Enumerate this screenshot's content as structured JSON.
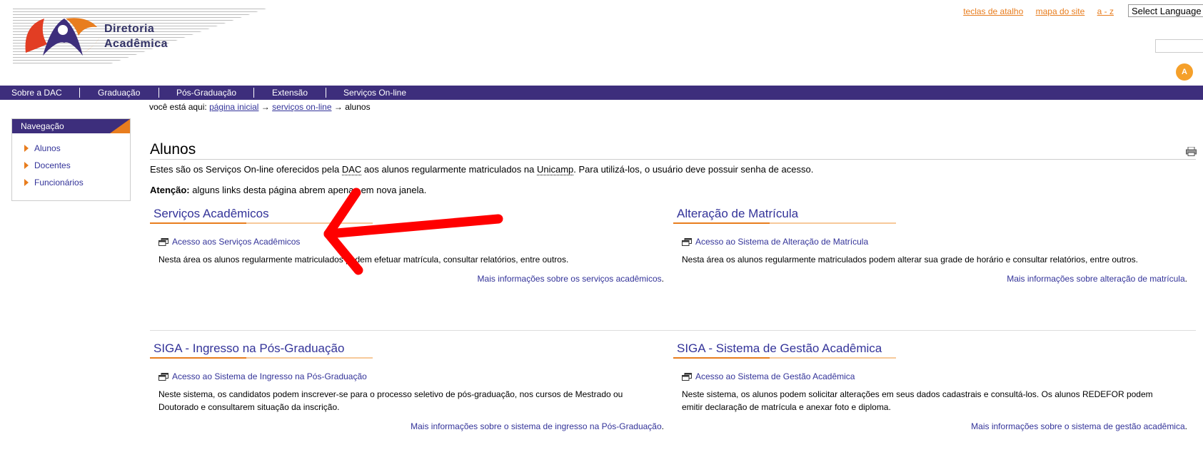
{
  "header": {
    "logo_line1": "Diretoria",
    "logo_line2": "Acadêmica",
    "top_links": [
      "teclas de atalho",
      "mapa do site",
      "a - z"
    ],
    "language_select": "Select Language",
    "accessibility_label": "A",
    "colors": {
      "nav_bg": "#3d2e7c",
      "accent": "#e87d1e",
      "link": "#333399"
    }
  },
  "nav": {
    "items": [
      "Sobre a DAC",
      "Graduação",
      "Pós-Graduação",
      "Extensão",
      "Serviços On-line"
    ]
  },
  "breadcrumb": {
    "prefix": "você está aqui:",
    "items": [
      "página inicial",
      "serviços on-line"
    ],
    "current": "alunos",
    "separator": "→"
  },
  "sidebar": {
    "title": "Navegação",
    "items": [
      "Alunos",
      "Docentes",
      "Funcionários"
    ]
  },
  "main": {
    "title": "Alunos",
    "intro_pre": "Estes são os Serviços On-line oferecidos pela",
    "intro_abbr1": "DAC",
    "intro_mid": "aos alunos regularmente matriculados na",
    "intro_abbr2": "Unicamp",
    "intro_post": ". Para utilizá-los, o usuário deve possuir senha de acesso.",
    "attention_label": "Atenção:",
    "attention_text": "alguns links desta página abrem apenas em nova janela.",
    "sections": [
      {
        "title": "Serviços Acadêmicos",
        "link": "Acesso aos Serviços Acadêmicos",
        "desc": "Nesta área os alunos regularmente matriculados podem efetuar matrícula, consultar relatórios, entre outros.",
        "more": "Mais informações sobre os serviços acadêmicos"
      },
      {
        "title": "Alteração de Matrícula",
        "link": "Acesso ao Sistema de Alteração de Matrícula",
        "desc": "Nesta área os alunos regularmente matriculados podem alterar sua grade de horário e consultar relatórios, entre outros.",
        "more": "Mais informações sobre alteração de matrícula"
      },
      {
        "title": "SIGA - Ingresso na Pós-Graduação",
        "link": "Acesso ao Sistema de Ingresso na Pós-Graduação",
        "desc": "Neste sistema, os candidatos podem inscrever-se para o processo seletivo de pós-graduação, nos cursos de Mestrado ou Doutorado e consultarem situação da inscrição.",
        "more": "Mais informações sobre o sistema de ingresso na Pós-Graduação"
      },
      {
        "title": "SIGA - Sistema de Gestão Acadêmica",
        "link": "Acesso ao Sistema de Gestão Acadêmica",
        "desc": "Neste sistema, os alunos podem solicitar alterações em seus dados cadastrais e consultá-los. Os alunos REDEFOR podem emitir declaração de matrícula e anexar foto e diploma.",
        "more": "Mais informações sobre o sistema de gestão acadêmica"
      }
    ]
  }
}
